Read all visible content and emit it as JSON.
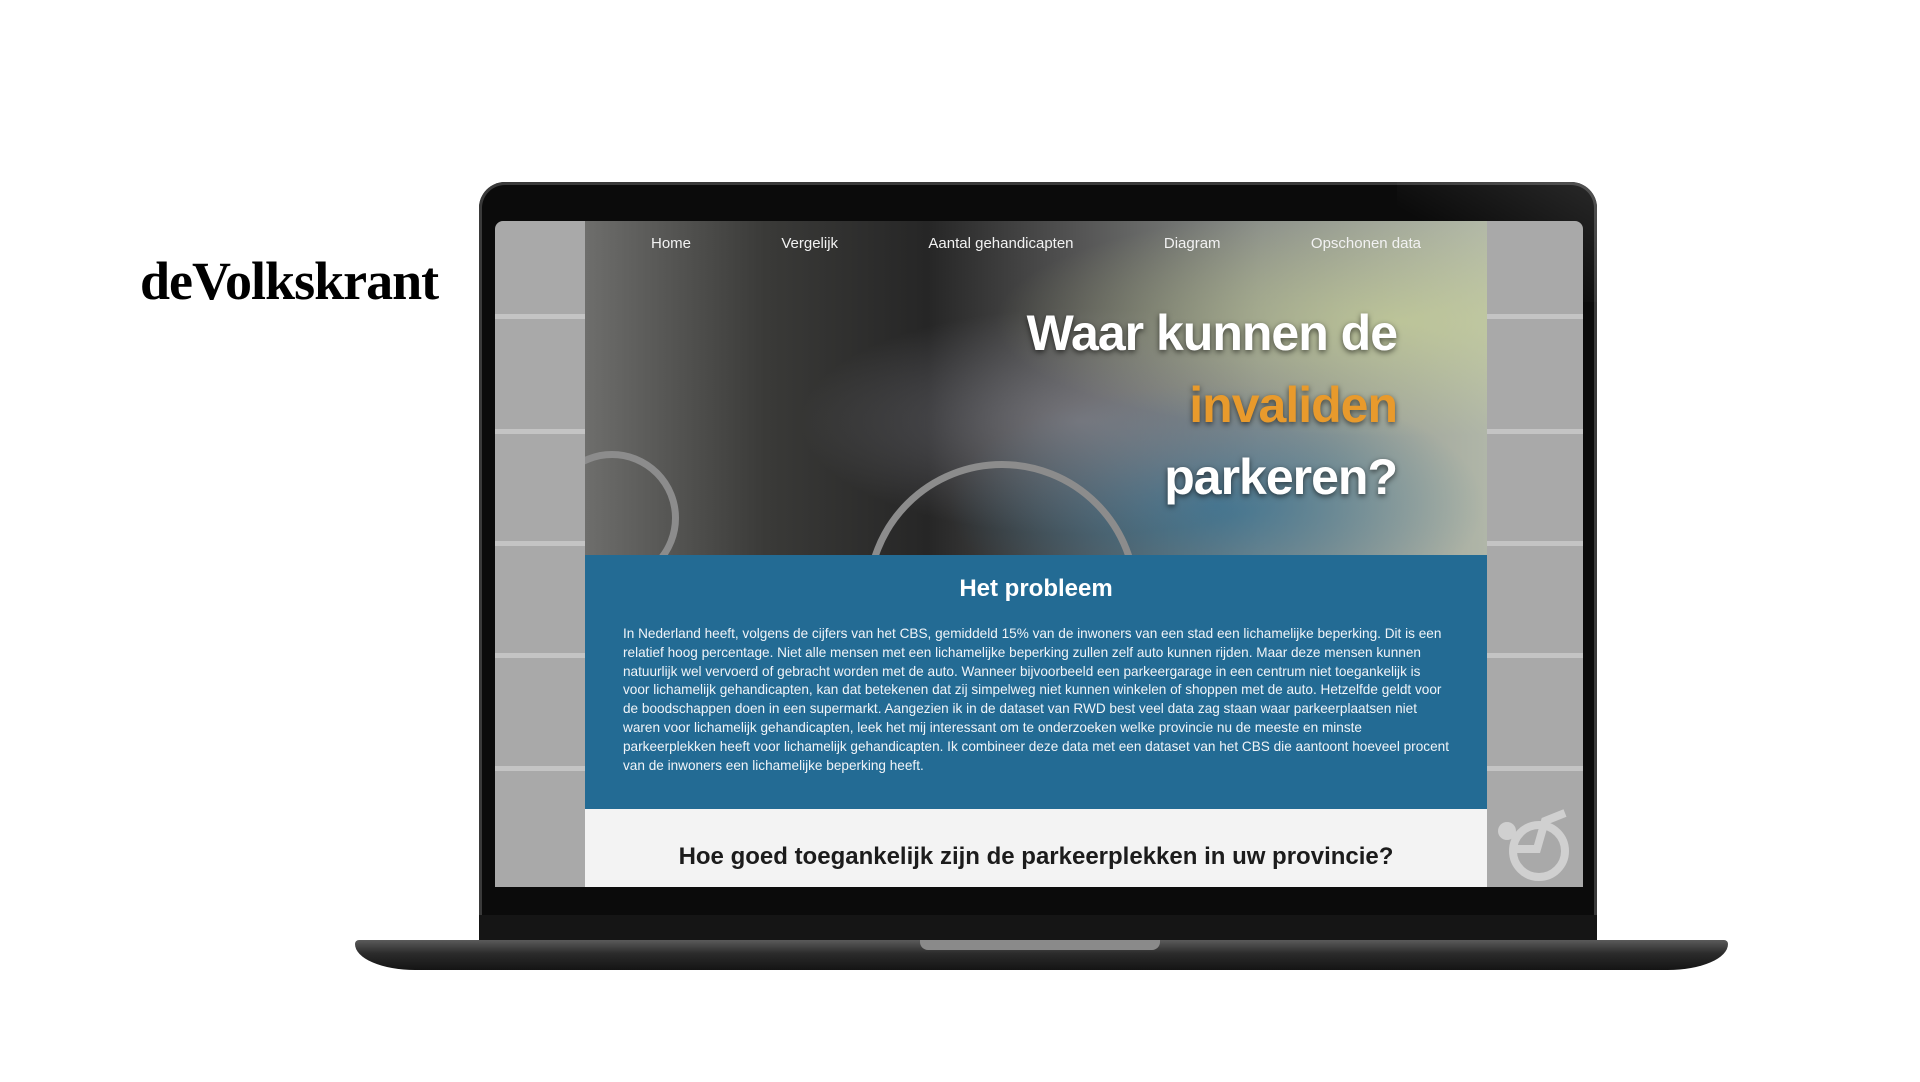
{
  "brand": {
    "logo_text": "deVolkskrant"
  },
  "nav": {
    "items": [
      "Home",
      "Vergelijk",
      "Aantal gehandicapten",
      "Diagram",
      "Opschonen data"
    ]
  },
  "hero": {
    "line1": "Waar kunnen de",
    "line2": "invaliden",
    "line3": "parkeren?"
  },
  "problem": {
    "heading": "Het probleem",
    "body": "In Nederland heeft, volgens de cijfers van het CBS, gemiddeld 15% van de inwoners van een stad een lichamelijke beperking. Dit is een relatief hoog percentage. Niet alle mensen met een lichamelijke beperking zullen zelf auto kunnen rijden. Maar deze mensen kunnen natuurlijk wel vervoerd of gebracht worden met de auto. Wanneer bijvoorbeeld een parkeergarage in een centrum niet toegankelijk is voor lichamelijk gehandicapten, kan dat betekenen dat zij simpelweg niet kunnen winkelen of shoppen met de auto. Hetzelfde geldt voor de boodschappen doen in een supermarkt. Aangezien ik in de dataset van RWD best veel data zag staan waar parkeerplaatsen niet waren voor lichamelijk gehandicapten, leek het mij interessant om te onderzoeken welke provincie nu de meeste en minste parkeerplekken heeft voor lichamelijk gehandicapten. Ik combineer deze data met een dataset van het CBS die aantoont hoeveel procent van de inwoners een lichamelijke beperking heeft."
  },
  "question": {
    "heading": "Hoe goed toegankelijk zijn de parkeerplekken in uw provincie?"
  },
  "colors": {
    "accent": "#e89a2c",
    "problem_bg": "#236b94",
    "screen_bg": "#a9a9a9"
  },
  "icons": {
    "background_icon": "wheelchair-icon"
  }
}
